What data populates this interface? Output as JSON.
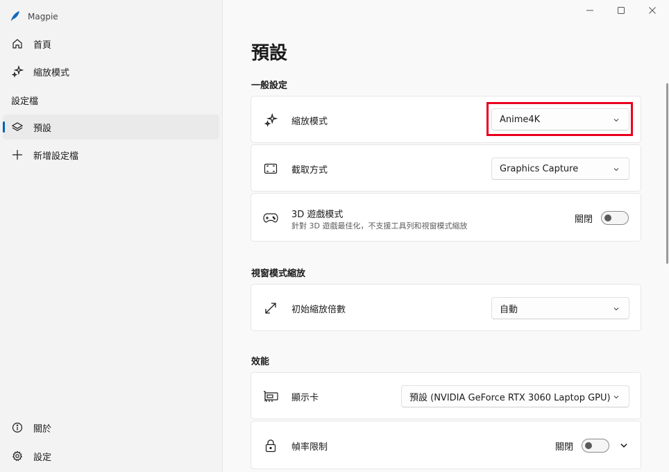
{
  "app": {
    "title": "Magpie"
  },
  "sidebar": {
    "items": [
      {
        "label": "首頁",
        "icon": "home-icon"
      },
      {
        "label": "縮放模式",
        "icon": "sparkle-icon"
      }
    ],
    "profiles_header": "設定檔",
    "profiles": [
      {
        "label": "預設",
        "icon": "layers-icon",
        "active": true
      },
      {
        "label": "新增設定檔",
        "icon": "plus-icon"
      }
    ],
    "footer": [
      {
        "label": "關於",
        "icon": "info-icon"
      },
      {
        "label": "設定",
        "icon": "gear-icon"
      }
    ]
  },
  "main": {
    "title": "預設",
    "groups": {
      "general": {
        "title": "一般設定",
        "scaling_mode": {
          "label": "縮放模式",
          "value": "Anime4K"
        },
        "capture": {
          "label": "截取方式",
          "value": "Graphics Capture"
        },
        "game_mode": {
          "label": "3D 遊戲模式",
          "description": "針對 3D 遊戲最佳化，不支援工具列和視窗模式縮放",
          "state": "關閉"
        }
      },
      "windowed": {
        "title": "視窗模式縮放",
        "initial_scale": {
          "label": "初始縮放倍數",
          "value": "自動"
        }
      },
      "performance": {
        "title": "效能",
        "gpu": {
          "label": "顯示卡",
          "value": "預設 (NVIDIA GeForce RTX 3060 Laptop GPU)"
        },
        "frame_limit": {
          "label": "幀率限制",
          "state": "關閉"
        }
      }
    }
  },
  "colors": {
    "accent": "#005fb8",
    "highlight": "#e8001c",
    "logo": "#0f6cbd"
  }
}
